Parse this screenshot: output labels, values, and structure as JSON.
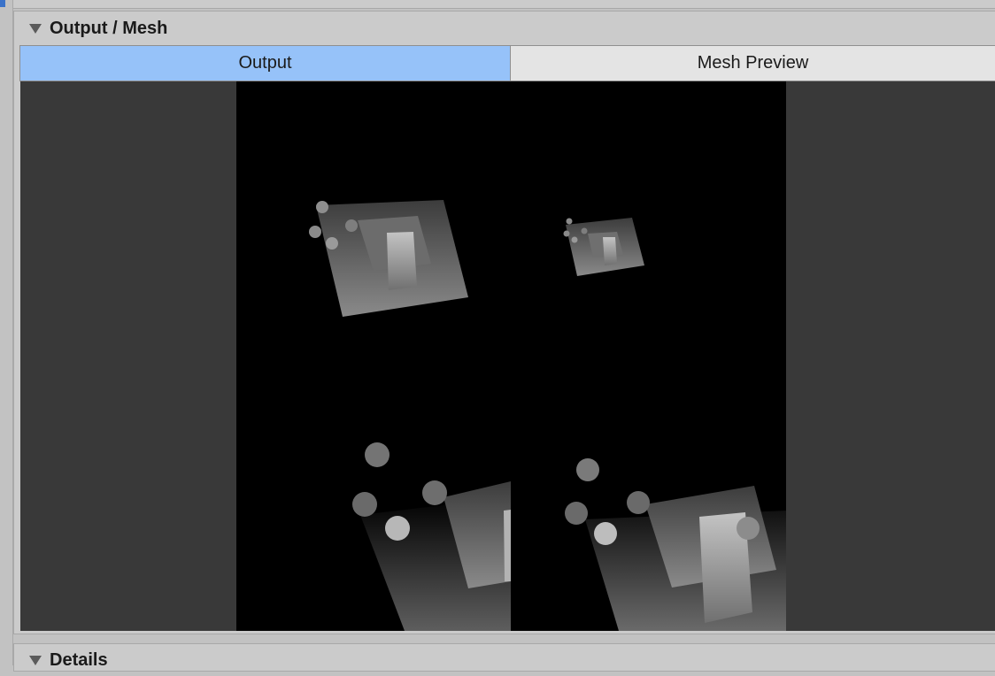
{
  "top_bar": {
    "title": "Output / Mesh"
  },
  "output_panel": {
    "title": "Output / Mesh",
    "foldout_icon": "triangle-down-icon",
    "tabs": [
      {
        "label": "Output",
        "selected": true
      },
      {
        "label": "Mesh Preview",
        "selected": false
      }
    ]
  },
  "details_panel": {
    "title": "Details",
    "foldout_icon": "triangle-down-icon"
  },
  "colors": {
    "tab_selected": "#96c2f9",
    "tab_unselected": "#e4e4e4",
    "viewport_bg": "#393939",
    "render_bg": "#000000"
  }
}
